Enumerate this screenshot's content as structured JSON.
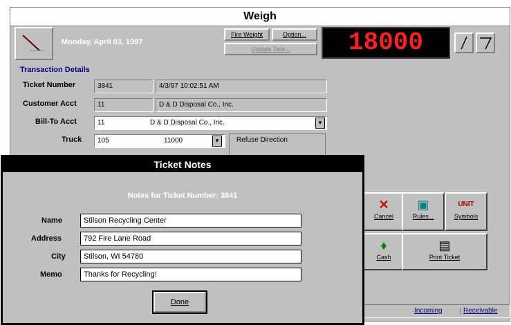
{
  "window": {
    "title": "Weigh"
  },
  "header": {
    "date": "Monday, April 03, 1997",
    "buttons": {
      "fire_weight": "Fire Weight",
      "option": "Option...",
      "update_tare": "Update Tare..."
    },
    "scale_value": "18000"
  },
  "transaction": {
    "section_title": "Transaction Details",
    "ticket_number_label": "Ticket Number",
    "ticket_number": "3841",
    "ticket_datetime": "4/3/97 10:02:51 AM",
    "customer_acct_label": "Customer Acct",
    "customer_acct": "11",
    "customer_name": "D & D Disposal Co., Inc.",
    "bill_to_label": "Bill-To Acct",
    "bill_to_acct": "11",
    "bill_to_name": "D & D Disposal Co., Inc.",
    "truck_label": "Truck",
    "truck_value": "105",
    "truck_tare": "11000",
    "refuse_direction_label": "Refuse Direction"
  },
  "actions": {
    "cancel": "Cancel",
    "rules": "Rules...",
    "symbols": "Symbols",
    "cash": "Cash",
    "print_ticket": "Print Ticket"
  },
  "status_tabs": {
    "incoming": "Incoming",
    "receivable": "Receivable"
  },
  "dialog": {
    "title": "Ticket Notes",
    "subtitle": "Notes for Ticket Number: 3841",
    "name_label": "Name",
    "name_value": "Stilson Recycling Center",
    "address_label": "Address",
    "address_value": "792 Fire Lane Road",
    "city_label": "City",
    "city_value": "Stilson, WI 54780",
    "memo_label": "Memo",
    "memo_value": "Thanks for Recycling!",
    "done_button": "Done"
  },
  "colors": {
    "scale_text": "#ff2020",
    "scale_bg": "#000000",
    "section_title": "#000080"
  }
}
